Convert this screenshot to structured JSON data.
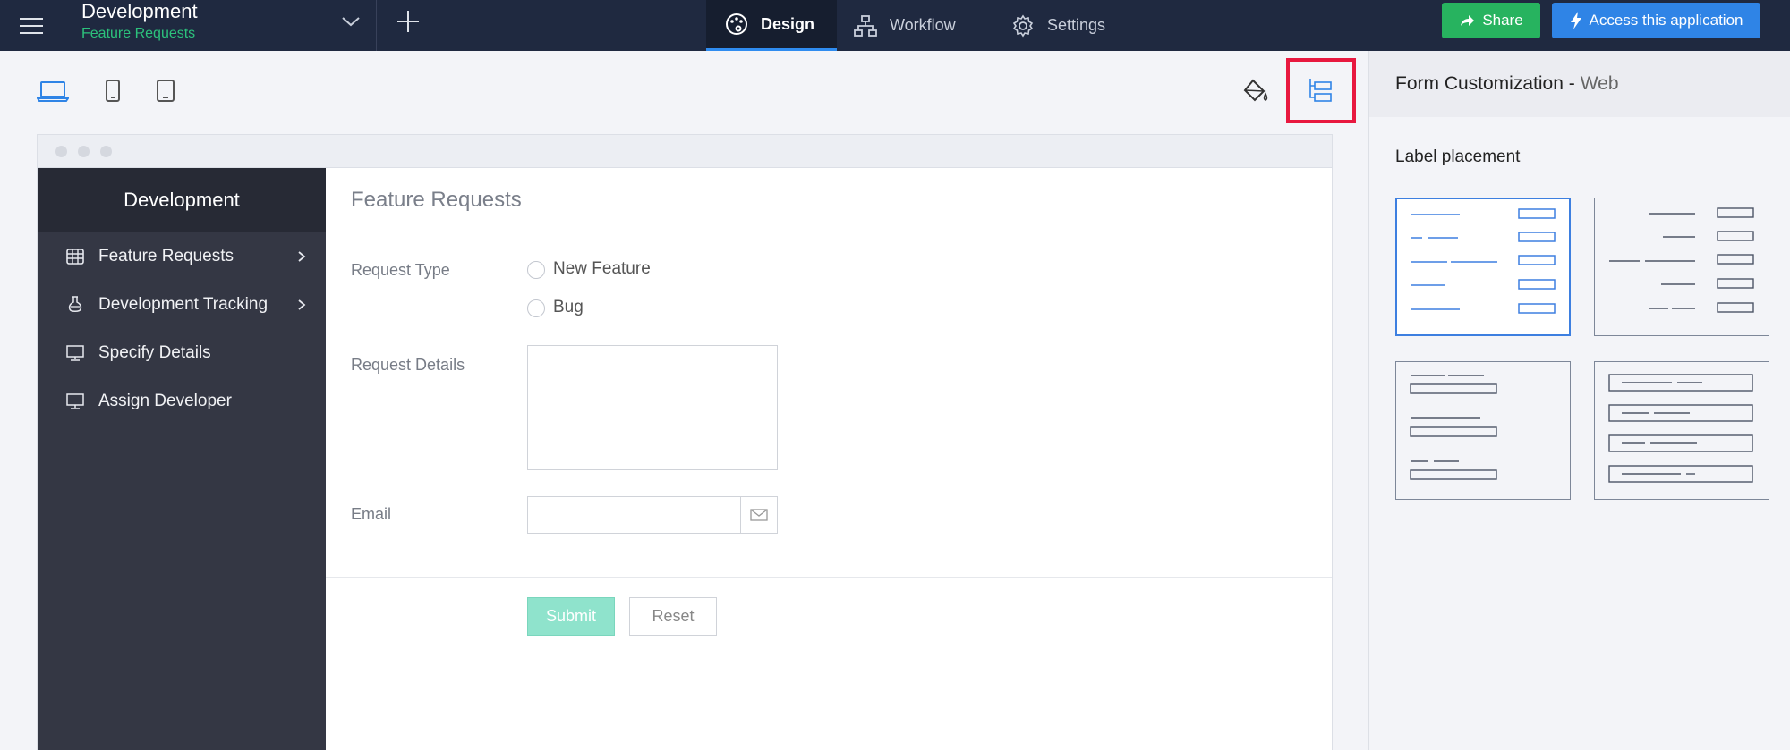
{
  "topbar": {
    "app_title": "Development",
    "app_subtitle": "Feature Requests",
    "tabs": [
      {
        "label": "Design",
        "icon": "palette-icon",
        "active": true
      },
      {
        "label": "Workflow",
        "icon": "workflow-icon",
        "active": false
      },
      {
        "label": "Settings",
        "icon": "gear-icon",
        "active": false
      }
    ],
    "share_label": "Share",
    "access_label": "Access this application"
  },
  "toolbar": {
    "devices": [
      "laptop-icon",
      "tablet-icon",
      "tablet-landscape-icon"
    ],
    "active_device": "laptop-icon",
    "tools": [
      "paint-bucket-icon",
      "form-layout-icon"
    ],
    "highlighted_tool": "form-layout-icon"
  },
  "preview": {
    "sidebar": {
      "title": "Development",
      "items": [
        {
          "label": "Feature Requests",
          "icon": "grid-report-icon",
          "has_submenu": true
        },
        {
          "label": "Development Tracking",
          "icon": "flask-icon",
          "has_submenu": true
        },
        {
          "label": "Specify Details",
          "icon": "monitor-icon",
          "has_submenu": false
        },
        {
          "label": "Assign Developer",
          "icon": "monitor-icon",
          "has_submenu": false
        }
      ]
    },
    "form": {
      "title": "Feature Requests",
      "request_type_label": "Request Type",
      "request_type_options": [
        "New Feature",
        "Bug"
      ],
      "request_details_label": "Request Details",
      "request_details_value": "",
      "email_label": "Email",
      "email_value": "",
      "submit_label": "Submit",
      "reset_label": "Reset"
    }
  },
  "panel": {
    "title": "Form Customization -",
    "title_suffix": "Web",
    "label_placement_heading": "Label placement",
    "options": [
      "left-aligned",
      "right-aligned",
      "top",
      "inside"
    ],
    "selected_option": "left-aligned"
  },
  "colors": {
    "topbar_bg": "#1f2940",
    "accent_green": "#27b35f",
    "accent_blue": "#2f84e6",
    "highlight_red": "#e8183f",
    "submit_bg": "#8fe3cc"
  }
}
